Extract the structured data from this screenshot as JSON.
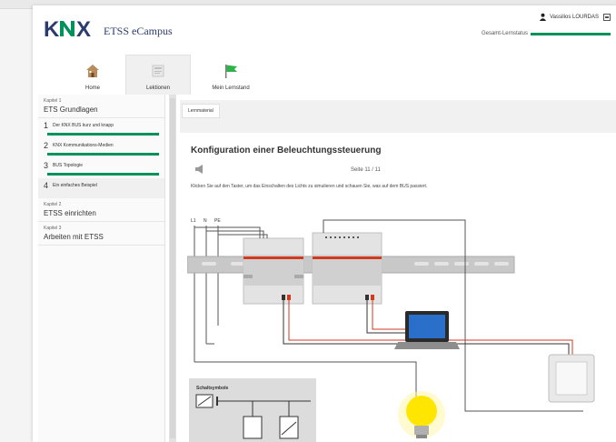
{
  "header": {
    "app_title": "ETSS eCampus",
    "user_name": "Vassilios LOURDAS",
    "status_label": "Gesamt-Lernstatus"
  },
  "nav_tabs": [
    {
      "label": "Home",
      "icon": "home-icon"
    },
    {
      "label": "Lektionen",
      "icon": "lessons-icon"
    },
    {
      "label": "Mein Lernstand",
      "icon": "flag-icon"
    }
  ],
  "sidebar": {
    "chapters": [
      {
        "label": "Kapitel 1",
        "title": "ETS Grundlagen",
        "lessons": [
          {
            "number": "1",
            "title": "Der KNX BUS kurz und knapp",
            "progress": 1.0
          },
          {
            "number": "2",
            "title": "KNX Kommunikations-Medien",
            "progress": 1.0
          },
          {
            "number": "3",
            "title": "BUS Topologie",
            "progress": 1.0
          },
          {
            "number": "4",
            "title": "Ein einfaches Beispiel",
            "progress": 0.0
          }
        ]
      },
      {
        "label": "Kapitel 2",
        "title": "ETSS einrichten"
      },
      {
        "label": "Kapitel 3",
        "title": "Arbeiten mit ETSS"
      }
    ]
  },
  "main": {
    "tab_label": "Lernmaterial",
    "heading": "Konfiguration einer Beleuchtungssteuerung",
    "page_indicator": "Seite 11 / 11",
    "instruction": "Klicken Sie auf den Taster, um das Einschalten des Lichts zu simulieren und schauen Sie, was auf dem BUS passiert.",
    "diagram": {
      "conductor_labels": [
        "L1",
        "N",
        "PE"
      ],
      "legend_title": "Schaltsymbole"
    }
  },
  "colors": {
    "brand_green": "#00925a",
    "knx_blue": "#2c3b6e",
    "bulb_yellow": "#ffe600",
    "bus_red": "#d23a1f"
  }
}
